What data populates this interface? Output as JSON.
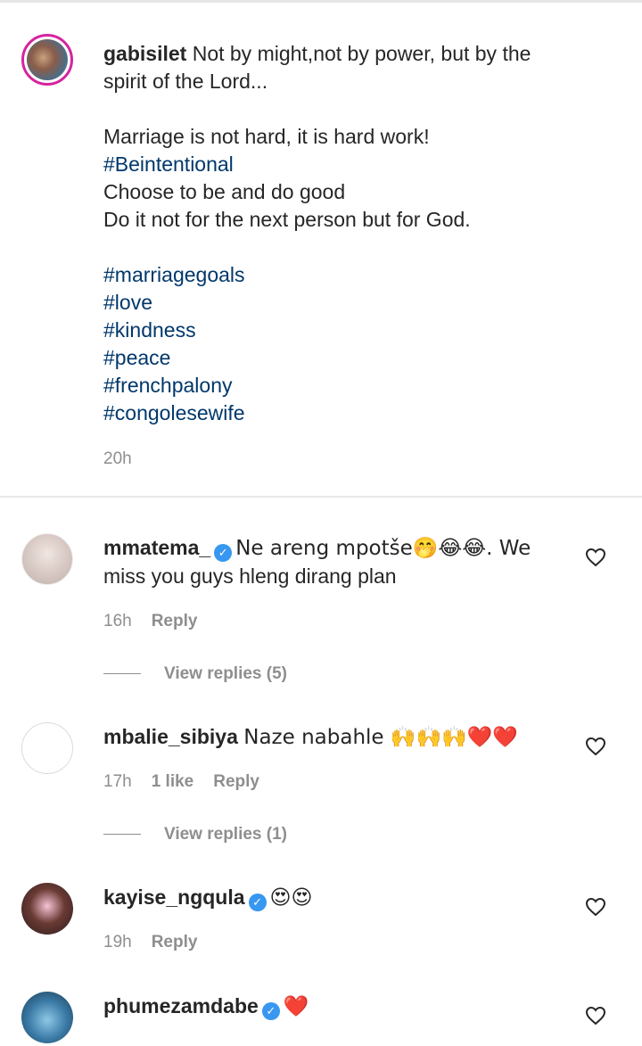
{
  "caption": {
    "username": "gabisilet",
    "lines": [
      "Not by might,not by power, but by the",
      "spirit of the Lord...",
      "",
      "Marriage is not hard, it is hard work!",
      "#Beintentional",
      "Choose to be and do good",
      "Do it not for the next person but for God.",
      "",
      "#marriagegoals",
      "#love",
      "#kindness",
      "#peace",
      "#frenchpalony",
      "#congolesewife"
    ],
    "time": "20h"
  },
  "comments": [
    {
      "username": "mmatema_",
      "verified": true,
      "text_line1": "Ne areng mpotše🤭😂😂. We",
      "text_line2": "miss you guys hleng dirang plan",
      "time": "16h",
      "likes": "",
      "reply_label": "Reply",
      "view_replies": "View replies (5)"
    },
    {
      "username": "mbalie_sibiya",
      "verified": false,
      "text_line1": "Naze nabahle 🙌🙌🙌❤️❤️",
      "time": "17h",
      "likes": "1 like",
      "reply_label": "Reply",
      "view_replies": "View replies (1)"
    },
    {
      "username": "kayise_ngqula",
      "verified": true,
      "text_line1": "😍😍",
      "time": "19h",
      "reply_label": "Reply"
    },
    {
      "username": "phumezamdabe",
      "verified": true,
      "text_line1": "❤️"
    }
  ],
  "icons": {
    "heart": "heart-outline-icon",
    "verified": "verified-badge-icon"
  },
  "colors": {
    "hashtag": "#00376b",
    "meta": "#8e8e8e",
    "verified": "#3897f0",
    "story_ring": "#d6249f"
  }
}
